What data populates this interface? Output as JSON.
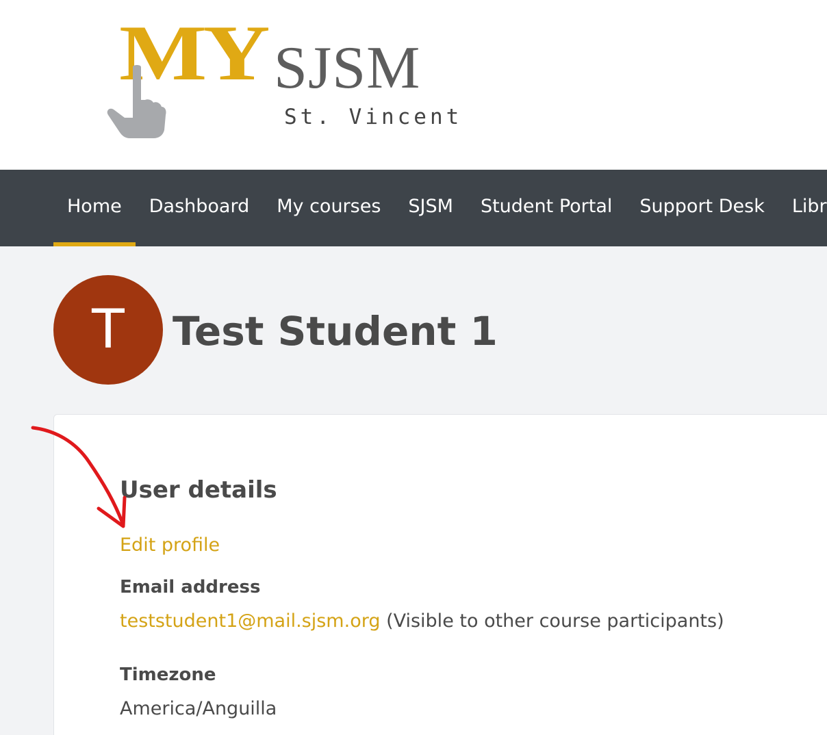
{
  "logo": {
    "my": "MY",
    "sjsm": "SJSM",
    "subtitle": "St. Vincent",
    "hand_icon": "pointing-hand-icon"
  },
  "nav": {
    "items": [
      {
        "label": "Home",
        "active": true
      },
      {
        "label": "Dashboard"
      },
      {
        "label": "My courses"
      },
      {
        "label": "SJSM"
      },
      {
        "label": "Student Portal"
      },
      {
        "label": "Support Desk"
      },
      {
        "label": "Library"
      }
    ]
  },
  "profile": {
    "avatar_initial": "T",
    "name": "Test Student 1"
  },
  "user_details": {
    "title": "User details",
    "edit_link": "Edit profile",
    "email_label": "Email address",
    "email": "teststudent1@mail.sjsm.org",
    "email_note": " (Visible to other course participants)",
    "timezone_label": "Timezone",
    "timezone": "America/Anguilla"
  },
  "colors": {
    "accent": "#e0a914",
    "link": "#d4a316",
    "nav_bg": "#3e444a",
    "avatar_bg": "#a0360f",
    "annotation": "#e0191c"
  }
}
